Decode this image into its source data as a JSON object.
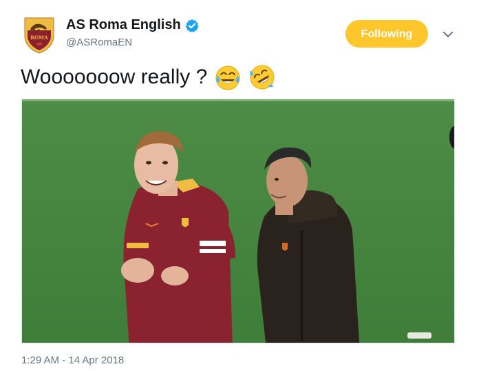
{
  "author": {
    "name": "AS Roma English",
    "handle": "@ASRomaEN",
    "verified": true,
    "avatar_icon": "as-roma-crest-icon"
  },
  "follow_button": {
    "label": "Following",
    "color": "#ffc72c"
  },
  "menu": {
    "icon": "chevron-down-icon"
  },
  "tweet": {
    "text": "Wooooooow really ?",
    "emojis": [
      "face-with-tears-of-joy-icon",
      "rolling-on-the-floor-laughing-icon"
    ]
  },
  "media": {
    "icon": "video-frame-two-men-on-pitch"
  },
  "timestamp": "1:29 AM - 14 Apr 2018",
  "colors": {
    "primary_text": "#14171a",
    "secondary_text": "#657786",
    "verified_blue": "#1da1f2",
    "pitch_green": "#3a7a35",
    "roma_maroon": "#8e1f2f",
    "roma_gold": "#f0bc42"
  }
}
